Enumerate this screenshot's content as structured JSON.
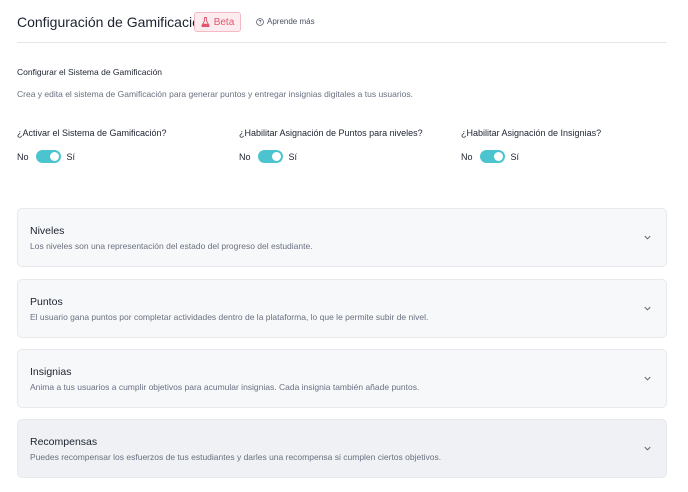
{
  "header": {
    "title": "Configuración de Gamificación",
    "beta_badge": "Beta",
    "learn_more": "Aprende más"
  },
  "intro": {
    "title": "Configurar el Sistema de Gamificación",
    "description": "Crea y edita el sistema de Gamificación para generar puntos y entregar insignias digitales a tus usuarios."
  },
  "settings": [
    {
      "label": "¿Activar el Sistema de Gamificación?",
      "off_label": "No",
      "on_label": "Sí",
      "enabled": true
    },
    {
      "label": "¿Habilitar Asignación de Puntos para niveles?",
      "off_label": "No",
      "on_label": "Sí",
      "enabled": true
    },
    {
      "label": "¿Habilitar Asignación de Insignias?",
      "off_label": "No",
      "on_label": "Sí",
      "enabled": true
    }
  ],
  "sections": [
    {
      "title": "Niveles",
      "description": "Los niveles son una representación del estado del progreso del estudiante."
    },
    {
      "title": "Puntos",
      "description": "El usuario gana puntos por completar actividades dentro de la plataforma, lo que le permite subir de nivel."
    },
    {
      "title": "Insignias",
      "description": "Anima a tus usuarios a cumplir objetivos para acumular insignias. Cada insignia también añade puntos."
    },
    {
      "title": "Recompensas",
      "description": "Puedes recompensar los esfuerzos de tus estudiantes y darles una recompensa si cumplen ciertos objetivos."
    }
  ],
  "icons": {
    "beta": "flask-icon",
    "learn_more": "help-circle-icon",
    "expand": "chevron-down-icon"
  },
  "colors": {
    "toggle_on": "#4cc4d0",
    "beta_text": "#e0566f",
    "beta_bg": "#fdecef"
  }
}
